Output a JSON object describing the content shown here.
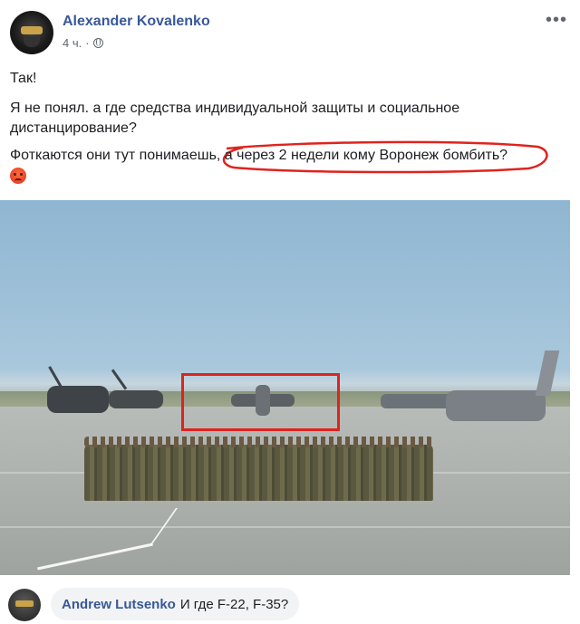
{
  "post": {
    "author": "Alexander Kovalenko",
    "time": "4 ч.",
    "privacy_icon": "globe-icon",
    "more_label": "•••",
    "line1": "Так!",
    "line2": "Я не понял. а где средства индивидуальной защиты и социальное дистанцирование?",
    "line3_prefix": "Фоткаются они тут понимаешь, ",
    "line3_highlight": "а через 2 недели кому Воронеж бомбить?",
    "emoji": "angry-face-icon",
    "highlight_color": "#e0231d",
    "link_color": "#385898"
  },
  "comment": {
    "author": "Andrew Lutsenko",
    "text": "И где F-22, F-35?"
  }
}
